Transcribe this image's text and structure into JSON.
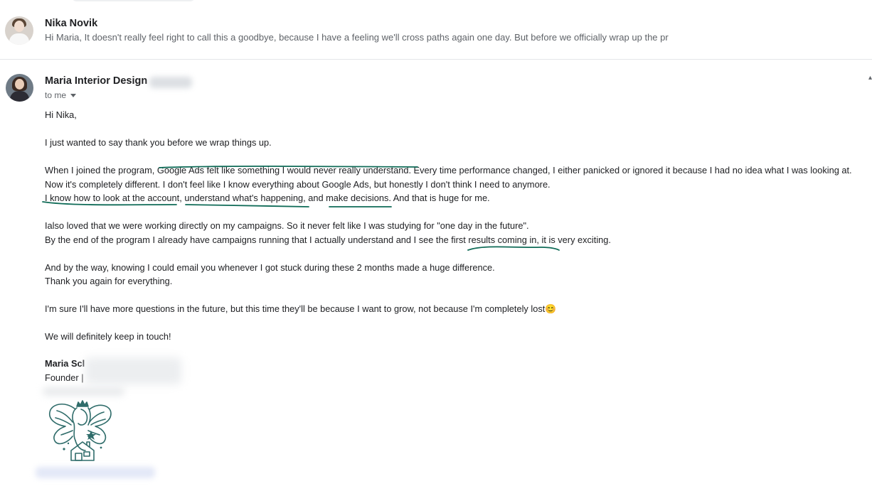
{
  "thread": {
    "collapsed_message": {
      "sender": "Nika Novik",
      "snippet": "Hi Maria, It doesn't really feel right to call this a goodbye, because I have a feeling we'll cross paths again one day. But before we officially wrap up the pr"
    },
    "message": {
      "sender": "Maria Interior Design",
      "recipient_label": "to me",
      "greeting": "Hi Nika,",
      "paragraphs": [
        "I just wanted to say thank you before we wrap things up.",
        "When I joined the program, Google Ads felt like something I would never really understand. Every time performance changed, I either panicked or ignored it because I had no idea what I was looking at.",
        "Now it's completely different. I don't feel like I know everything about Google Ads, but honestly I don't think I need to anymore.",
        "I know how to look at the account, understand what's happening, and make decisions. And that is huge for me.",
        "Ialso loved that we were working directly on my campaigns. So it never felt like I was studying for \"one day in the future\".",
        "By the end of the program I already have campaigns running that I actually understand and I see the first results coming in, it is very exciting.",
        "And by the way, knowing I could email you whenever I got stuck during these 2 months made a huge difference.",
        "Thank you again for everything.",
        "I'm sure I'll have more questions in the future, but this time they'll be because I want to grow, not because I'm completely lost😊",
        "We will definitely keep in touch!"
      ],
      "signature": {
        "name": "Maria Scl",
        "title": "Founder |"
      }
    }
  },
  "colors": {
    "annotation_ink": "#0f6b57",
    "logo_ink": "#2f6c6a"
  },
  "icons": [
    "dropdown-caret-icon",
    "fairy-house-logo"
  ]
}
